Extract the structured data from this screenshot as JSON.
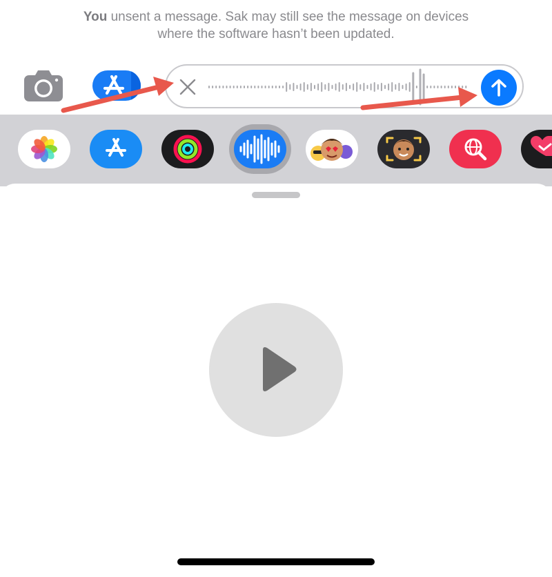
{
  "notice": {
    "line1_prefix": "You",
    "line1_rest": " unsent a message. Sak may still see the message on devices",
    "line2": "where the software hasn’t been updated."
  },
  "colors": {
    "accent": "#0a7aff",
    "annotation_arrow": "#e8584c",
    "drawer_background": "#d2d2d6"
  },
  "toolbar": {
    "camera": {
      "icon": "camera-icon"
    },
    "app_store": {
      "icon": "app-store-icon"
    }
  },
  "voice_message": {
    "cancel_icon": "close-icon",
    "send_icon": "arrow-up-icon"
  },
  "app_drawer": {
    "apps": [
      {
        "id": "photos",
        "icon": "photos-icon"
      },
      {
        "id": "app-store",
        "icon": "app-store-icon"
      },
      {
        "id": "fitness",
        "icon": "activity-rings-icon"
      },
      {
        "id": "audio",
        "icon": "audio-waveform-icon",
        "selected": true
      },
      {
        "id": "memoji-stickers",
        "icon": "memoji-stickers-icon"
      },
      {
        "id": "memoji",
        "icon": "memoji-icon"
      },
      {
        "id": "images-search",
        "icon": "globe-search-icon"
      },
      {
        "id": "digital-touch",
        "icon": "heart-icon"
      }
    ]
  },
  "player": {
    "icon": "play-icon"
  }
}
